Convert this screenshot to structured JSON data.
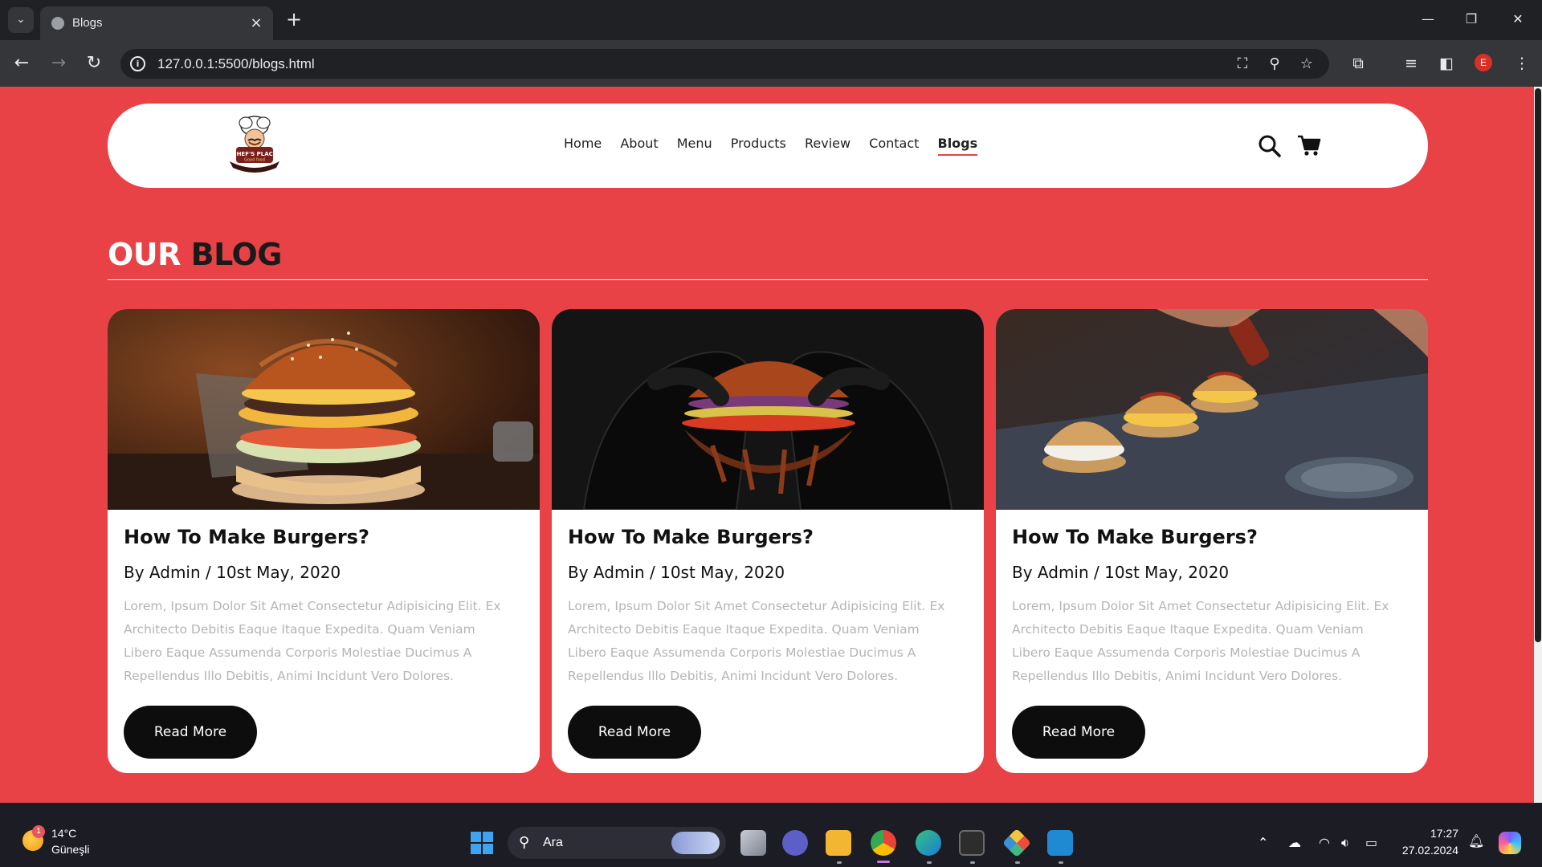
{
  "browser": {
    "tab_title": "Blogs",
    "url": "127.0.0.1:5500/blogs.html",
    "profile_initial": "E"
  },
  "site": {
    "logo_text": "CHEF'S PLACE",
    "logo_subtext": "Good food",
    "nav": [
      {
        "label": "Home"
      },
      {
        "label": "About"
      },
      {
        "label": "Menu"
      },
      {
        "label": "Products"
      },
      {
        "label": "Review"
      },
      {
        "label": "Contact"
      },
      {
        "label": "Blogs",
        "active": true
      }
    ],
    "section_title_1": "OUR",
    "section_title_2": "BLOG",
    "posts": [
      {
        "title": "How To Make Burgers?",
        "meta": "By Admin / 10st May, 2020",
        "excerpt": "Lorem, Ipsum Dolor Sit Amet Consectetur Adipisicing Elit. Ex Architecto Debitis Eaque Itaque Expedita. Quam Veniam Libero Eaque Assumenda Corporis Molestiae Ducimus A Repellendus Illo Debitis, Animi Incidunt Vero Dolores.",
        "button": "Read More"
      },
      {
        "title": "How To Make Burgers?",
        "meta": "By Admin / 10st May, 2020",
        "excerpt": "Lorem, Ipsum Dolor Sit Amet Consectetur Adipisicing Elit. Ex Architecto Debitis Eaque Itaque Expedita. Quam Veniam Libero Eaque Assumenda Corporis Molestiae Ducimus A Repellendus Illo Debitis, Animi Incidunt Vero Dolores.",
        "button": "Read More"
      },
      {
        "title": "How To Make Burgers?",
        "meta": "By Admin / 10st May, 2020",
        "excerpt": "Lorem, Ipsum Dolor Sit Amet Consectetur Adipisicing Elit. Ex Architecto Debitis Eaque Itaque Expedita. Quam Veniam Libero Eaque Assumenda Corporis Molestiae Ducimus A Repellendus Illo Debitis, Animi Incidunt Vero Dolores.",
        "button": "Read More"
      }
    ],
    "colors": {
      "accent": "#e84246",
      "button": "#0d0d0d"
    }
  },
  "taskbar": {
    "weather_temp": "14°C",
    "weather_condition": "Güneşli",
    "weather_badge": "1",
    "search_label": "Ara",
    "time": "17:27",
    "date": "27.02.2024"
  }
}
